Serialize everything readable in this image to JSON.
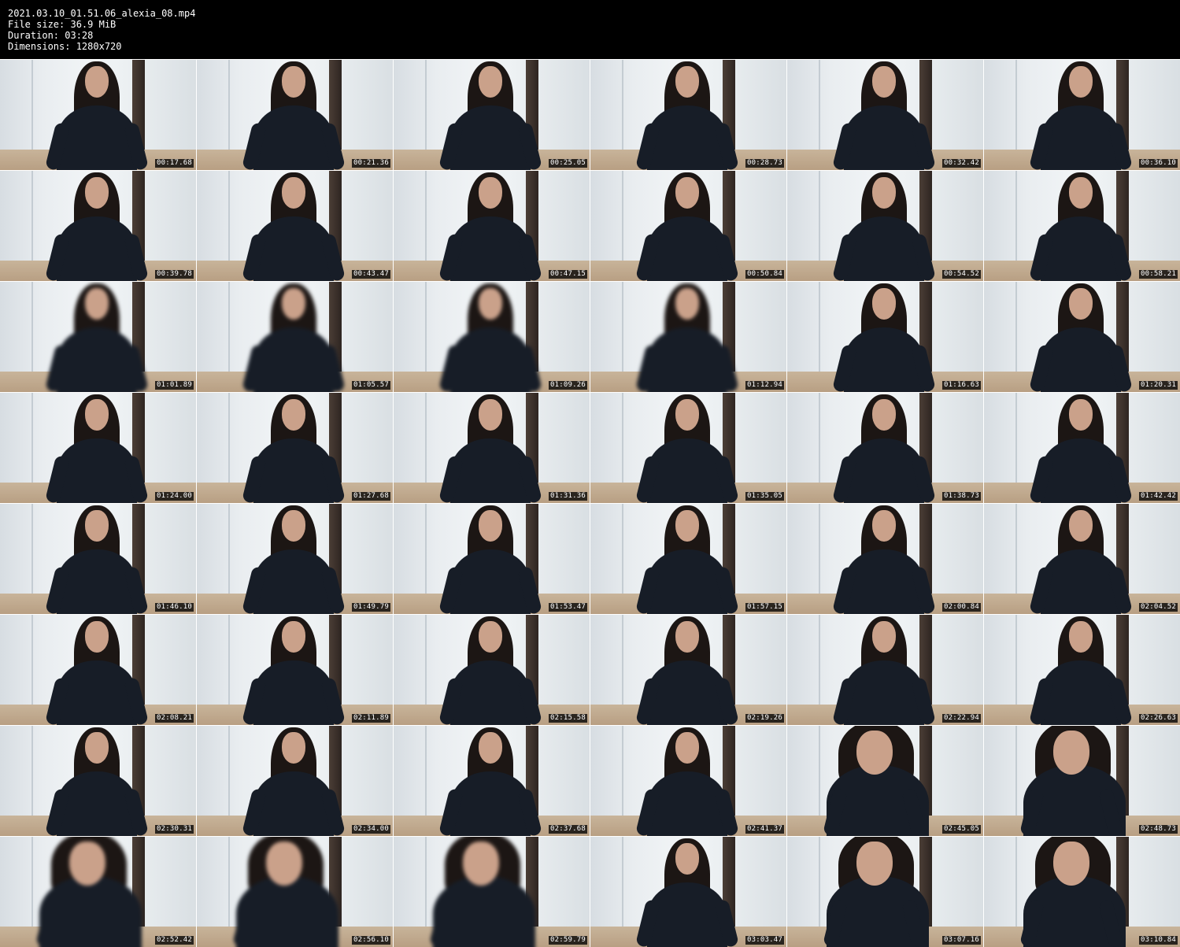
{
  "header": {
    "filename": "2021.03.10_01.51.06_alexia_08.mp4",
    "file_size": "File size: 36.9 MiB",
    "duration": "Duration: 03:28",
    "dimensions": "Dimensions: 1280x720"
  },
  "grid": {
    "columns": 6,
    "rows": 8,
    "timestamps": [
      "00:17.68",
      "00:21.36",
      "00:25.05",
      "00:28.73",
      "00:32.42",
      "00:36.10",
      "00:39.78",
      "00:43.47",
      "00:47.15",
      "00:50.84",
      "00:54.52",
      "00:58.21",
      "01:01.89",
      "01:05.57",
      "01:09.26",
      "01:12.94",
      "01:16.63",
      "01:20.31",
      "01:24.00",
      "01:27.68",
      "01:31.36",
      "01:35.05",
      "01:38.73",
      "01:42.42",
      "01:46.10",
      "01:49.79",
      "01:53.47",
      "01:57.15",
      "02:00.84",
      "02:04.52",
      "02:08.21",
      "02:11.89",
      "02:15.58",
      "02:19.26",
      "02:22.94",
      "02:26.63",
      "02:30.31",
      "02:34.00",
      "02:37.68",
      "02:41.37",
      "02:45.05",
      "02:48.73",
      "02:52.42",
      "02:56.10",
      "02:59.79",
      "03:03.47",
      "03:07.16",
      "03:10.84"
    ]
  },
  "colors": {
    "header_background": "#000000",
    "header_text": "#ffffff",
    "timestamp_background": "#000000",
    "timestamp_text": "#ffffff",
    "wall": "#eef1f3",
    "floor": "#bfa78b",
    "outfit": "#171d27",
    "hair": "#1c1614"
  }
}
